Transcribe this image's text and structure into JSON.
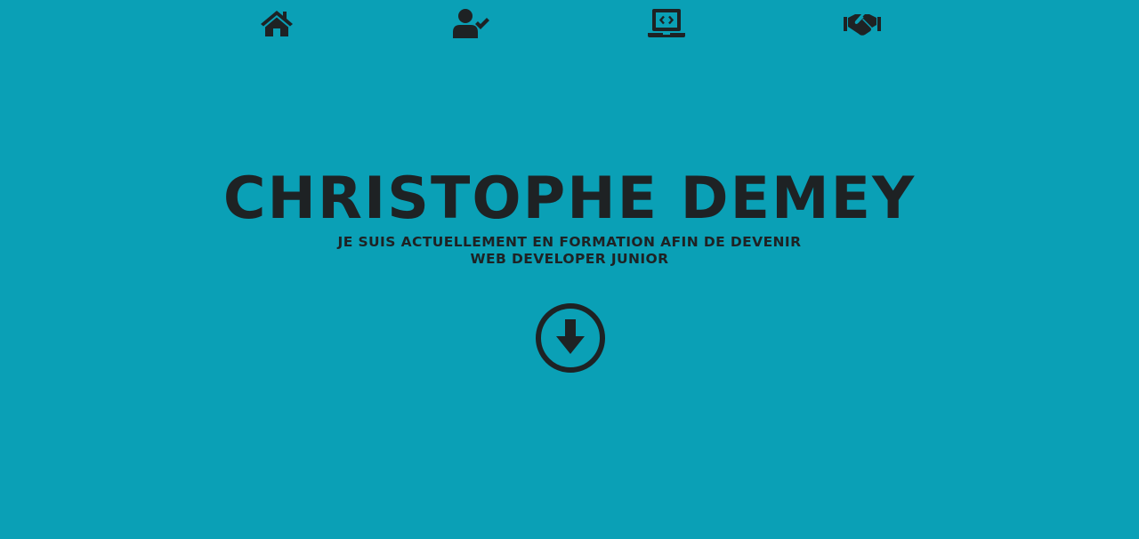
{
  "nav": {
    "items": [
      {
        "icon": "home-icon"
      },
      {
        "icon": "user-check-icon"
      },
      {
        "icon": "laptop-code-icon"
      },
      {
        "icon": "handshake-icon"
      }
    ]
  },
  "hero": {
    "title": "CHRISTOPHE DEMEY",
    "subtitle": "JE SUIS ACTUELLEMENT EN FORMATION AFIN DE DEVENIR WEB DEVELOPER JUNIOR",
    "scroll_icon": "arrow-circle-down-icon"
  },
  "colors": {
    "background": "#0aa0b6",
    "foreground": "#1e2224"
  }
}
